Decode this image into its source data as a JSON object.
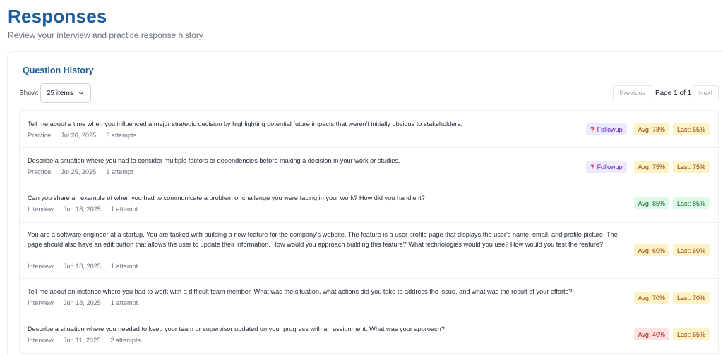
{
  "header": {
    "title": "Responses",
    "subtitle": "Review your interview and practice response history"
  },
  "history": {
    "title": "Question History",
    "show_label": "Show:",
    "page_size": "25 items",
    "pager": {
      "previous": "Previous",
      "page_info": "Page 1 of 1",
      "next": "Next"
    },
    "rows": [
      {
        "question": "Tell me about a time when you influenced a major strategic decision by highlighting potential future impacts that weren't initially obvious to stakeholders.",
        "type": "Practice",
        "date": "Jul 26, 2025",
        "attempts": "3 attempts",
        "followup": "Followup",
        "avg": "Avg: 78%",
        "avg_color": "yellow",
        "last": "Last: 65%",
        "last_color": "yellow"
      },
      {
        "question": "Describe a situation where you had to consider multiple factors or dependencies before making a decision in your work or studies.",
        "type": "Practice",
        "date": "Jul 25, 2025",
        "attempts": "1 attempt",
        "followup": "Followup",
        "avg": "Avg: 75%",
        "avg_color": "yellow",
        "last": "Last: 75%",
        "last_color": "yellow"
      },
      {
        "question": "Can you share an example of when you had to communicate a problem or challenge you were facing in your work? How did you handle it?",
        "type": "Interview",
        "date": "Jun 18, 2025",
        "attempts": "1 attempt",
        "avg": "Avg: 85%",
        "avg_color": "green",
        "last": "Last: 85%",
        "last_color": "green"
      },
      {
        "question": "You are a software engineer at a startup. You are tasked with building a new feature for the company's website. The feature is a user profile page that displays the user's name, email, and profile picture. The page should also have an edit button that allows the user to update their information. How would you approach building this feature? What technologies would you use? How would you test the feature?",
        "type": "Interview",
        "date": "Jun 18, 2025",
        "attempts": "1 attempt",
        "avg": "Avg: 60%",
        "avg_color": "yellow",
        "last": "Last: 60%",
        "last_color": "yellow"
      },
      {
        "question": "Tell me about an instance where you had to work with a difficult team member. What was the situation, what actions did you take to address the issue, and what was the result of your efforts?",
        "type": "Interview",
        "date": "Jun 18, 2025",
        "attempts": "1 attempt",
        "avg": "Avg: 70%",
        "avg_color": "yellow",
        "last": "Last: 70%",
        "last_color": "yellow"
      },
      {
        "question": "Describe a situation where you needed to keep your team or supervisor updated on your progress with an assignment. What was your approach?",
        "type": "Interview",
        "date": "Jun 11, 2025",
        "attempts": "2 attempts",
        "avg": "Avg: 40%",
        "avg_color": "red",
        "last": "Last: 65%",
        "last_color": "yellow"
      }
    ]
  }
}
